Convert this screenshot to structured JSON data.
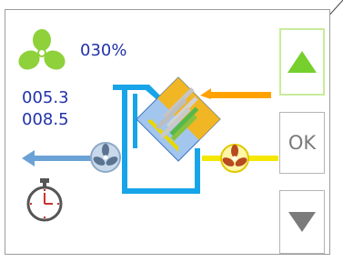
{
  "status": {
    "fan_speed": "030%",
    "temperature_1": "005.3",
    "temperature_2": "008.5"
  },
  "controls": {
    "ok_label": "OK"
  },
  "icons": {
    "fan": "fan-icon",
    "timer": "stopwatch-icon",
    "up": "triangle-up-icon",
    "down": "triangle-down-icon"
  },
  "colors": {
    "fan_green": "#8ed13a",
    "text_blue": "#2233aa",
    "supply_air": "#18a4e8",
    "exhaust_air": "#ffa200",
    "fresh_air": "#f4e800",
    "up_arrow": "#77cf2e",
    "down_arrow": "#7b7b7b"
  }
}
